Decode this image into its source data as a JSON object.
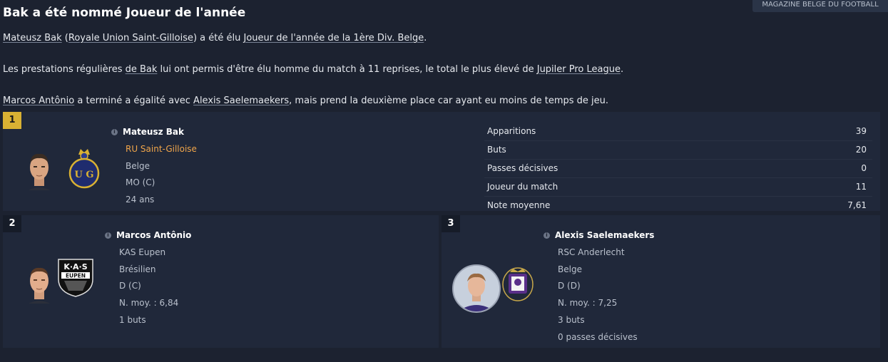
{
  "source_tag": "MAGAZINE BELGE DU FOOTBALL",
  "headline": "Bak a été nommé Joueur de l'année",
  "paragraph1": {
    "p1_player": "Mateusz Bak",
    "p1_open": " (",
    "p1_club": "Royale Union Saint-Gilloise",
    "p1_mid": ") a été élu ",
    "p1_award": "Joueur de l'année de la 1ère Div. Belge",
    "p1_end": "."
  },
  "paragraph2": {
    "p2_start": "Les prestations régulières ",
    "p2_link": "de Bak",
    "p2_mid": " lui ont permis d'être élu homme du match à 11 reprises, le total le plus élevé de ",
    "p2_league": "Jupiler Pro League",
    "p2_end": "."
  },
  "paragraph3": {
    "p3_player": "Marcos Antônio",
    "p3_mid": " a terminé a égalité avec ",
    "p3_player2": "Alexis Saelemaekers",
    "p3_end": ", mais prend la deuxième place car ayant eu moins de temps de jeu."
  },
  "first": {
    "rank": "1",
    "name": "Mateusz Bak",
    "club": "RU Saint-Gilloise",
    "nationality": "Belge",
    "position": "MO (C)",
    "age": "24 ans",
    "club_color": "#f0a54a"
  },
  "stats": [
    {
      "label": "Apparitions",
      "value": "39"
    },
    {
      "label": "Buts",
      "value": "20"
    },
    {
      "label": "Passes décisives",
      "value": "0"
    },
    {
      "label": "Joueur du match",
      "value": "11"
    },
    {
      "label": "Note moyenne",
      "value": "7,61"
    }
  ],
  "second": {
    "rank": "2",
    "name": "Marcos Antônio",
    "club": "KAS Eupen",
    "nationality": "Brésilien",
    "position": "D (C)",
    "rating": "N. moy. : 6,84",
    "goals": "1 buts"
  },
  "third": {
    "rank": "3",
    "name": "Alexis Saelemaekers",
    "club": "RSC Anderlecht",
    "nationality": "Belge",
    "position": "D (D)",
    "rating": "N. moy. : 7,25",
    "goals": "3 buts",
    "assists": "0 passes décisives"
  },
  "crests": {
    "eupen_line1": "K·A·S",
    "eupen_line2": "EUPEN",
    "usg_letters": "U G"
  },
  "icons": {
    "info": "info-icon",
    "info_glyph": "i"
  },
  "colors": {
    "background": "#1c2230",
    "panel": "#20283a",
    "gold": "#d9b133"
  }
}
